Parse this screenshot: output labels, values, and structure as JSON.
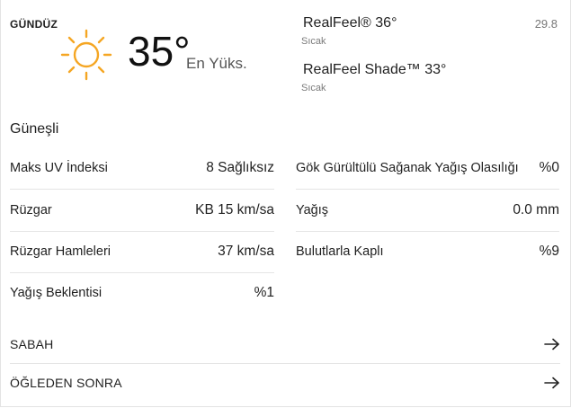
{
  "day": {
    "label": "GÜNDÜZ",
    "temperature": "35°",
    "temp_label": "En Yüks.",
    "realfeel": "RealFeel® 36°",
    "realfeel_desc": "Sıcak",
    "realfeel_shade": "RealFeel Shade™ 33°",
    "realfeel_shade_desc": "Sıcak",
    "side_value": "29.8",
    "phrase": "Güneşli",
    "icon": "sun-icon",
    "accent": "#f5a623"
  },
  "details_left": [
    {
      "label": "Maks UV İndeksi",
      "value": "8 Sağlıksız"
    },
    {
      "label": "Rüzgar",
      "value": "KB 15 km/sa"
    },
    {
      "label": "Rüzgar Hamleleri",
      "value": "37 km/sa"
    },
    {
      "label": "Yağış Beklentisi",
      "value": "%1"
    }
  ],
  "details_right": [
    {
      "label": "Gök Gürültülü Sağanak Yağış Olasılığı",
      "value": "%0"
    },
    {
      "label": "Yağış",
      "value": "0.0 mm"
    },
    {
      "label": "Bulutlarla Kaplı",
      "value": "%9"
    }
  ],
  "nav": [
    {
      "label": "SABAH",
      "icon": "arrow-right-icon"
    },
    {
      "label": "ÖĞLEDEN SONRA",
      "icon": "arrow-right-icon"
    }
  ]
}
